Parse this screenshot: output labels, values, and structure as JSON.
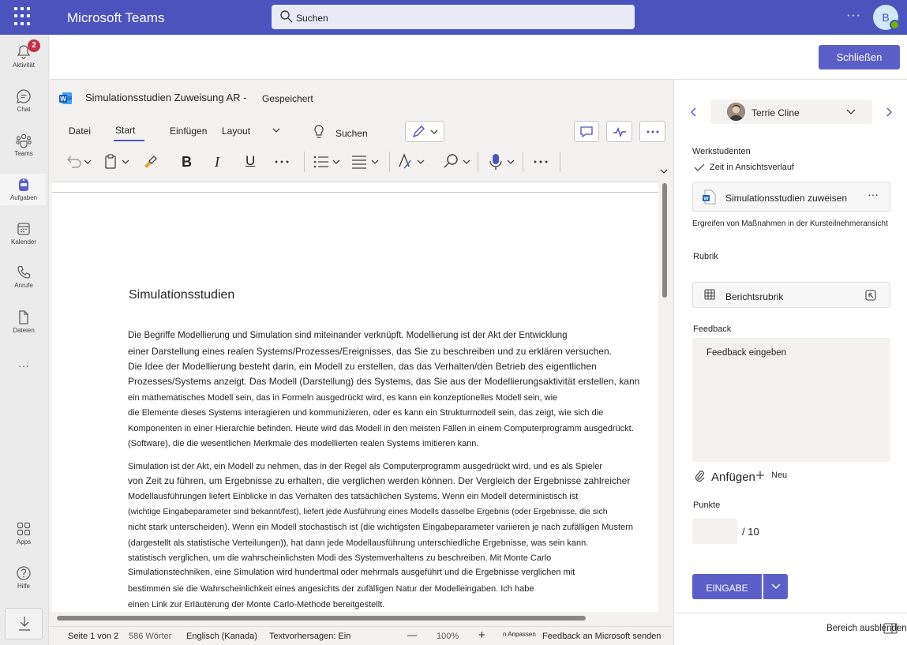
{
  "topbar": {
    "app_title": "Microsoft Teams",
    "search_placeholder": "Suchen",
    "more": "···",
    "avatar_initial": "B"
  },
  "rail": {
    "items": [
      {
        "label": "Aktivität",
        "icon": "bell-icon",
        "badge": "2"
      },
      {
        "label": "Chat",
        "icon": "chat-icon"
      },
      {
        "label": "Teams",
        "icon": "teams-icon"
      },
      {
        "label": "Aufgaben",
        "icon": "assignments-icon",
        "active": true
      },
      {
        "label": "Kalender",
        "icon": "calendar-icon"
      },
      {
        "label": "Anrufe",
        "icon": "phone-icon"
      },
      {
        "label": "Dateien",
        "icon": "file-icon"
      },
      {
        "label": "",
        "icon": "more-icon"
      },
      {
        "label": "Apps",
        "icon": "apps-icon"
      },
      {
        "label": "Hilfe",
        "icon": "help-icon"
      }
    ],
    "more_label": "···"
  },
  "header": {
    "close_label": "Schließen"
  },
  "document": {
    "title": "Simulationsstudien Zuweisung AR -",
    "saved": "Gespeichert",
    "tabs": [
      "Datei",
      "Start",
      "Einfügen",
      "Layout"
    ],
    "ribbon_search": "Suchen",
    "heading": "Simulationsstudien",
    "paragraph1": [
      "Die Begriffe Modellierung und Simulation sind miteinander verknüpft. Modellierung ist der Akt der Entwicklung",
      "einer Darstellung eines realen Systems/Prozesses/Ereignisses, das Sie zu beschreiben und zu erklären versuchen.",
      "Die Idee der Modellierung besteht darin, ein Modell zu erstellen, das das Verhalten/den Betrieb des eigentlichen",
      "Prozesses/Systems anzeigt. Das Modell (Darstellung) des Systems, das Sie aus der Modellierungsaktivität erstellen, kann",
      "ein mathematisches Modell sein, das in Formeln ausgedrückt wird, es kann ein konzeptionelles Modell sein, wie",
      "die Elemente dieses Systems interagieren und kommunizieren, oder es kann ein Strukturmodell sein, das zeigt, wie sich die",
      "Komponenten in einer Hierarchie befinden. Heute wird das Modell in den meisten Fällen in einem Computerprogramm ausgedrückt.",
      "(Software), die die wesentlichen Merkmale des modellierten realen Systems imitieren kann."
    ],
    "paragraph2": [
      "Simulation ist der Akt, ein Modell zu nehmen, das in der Regel als Computerprogramm ausgedrückt wird, und es als Spieler",
      "von Zeit zu führen, um Ergebnisse zu erhalten, die verglichen werden können. Der Vergleich der Ergebnisse zahlreicher",
      "Modellausführungen liefert Einblicke in das Verhalten des tatsächlichen Systems. Wenn ein Modell deterministisch ist",
      "(wichtige Eingabeparameter sind bekannt/fest), liefert jede Ausführung eines Modells dasselbe Ergebnis (oder Ergebnisse, die sich",
      "nicht stark unterscheiden). Wenn ein Modell stochastisch ist (die wichtigsten Eingabeparameter variieren je nach zufälligen Mustern",
      "(dargestellt als statistische Verteilungen)), hat dann jede Modellausführung unterschiedliche Ergebnisse, was sein kann.",
      "statistisch verglichen, um die wahrscheinlichsten Modi des Systemverhaltens zu beschreiben. Mit Monte Carlo",
      "Simulationstechniken, eine Simulation wird hundertmal oder mehrmals ausgeführt und die Ergebnisse verglichen mit",
      "bestimmen sie die Wahrscheinlichkeit eines angesichts der zufälligen Natur der Modelleingaben. Ich habe",
      "einen Link zur Erläuterung der Monte Carlo-Methode bereitgestellt."
    ]
  },
  "statusbar": {
    "page": "Seite 1 von 2",
    "words": "586 Wörter",
    "language": "Englisch (Kanada)",
    "predictions": "Textvorhersagen: Ein",
    "zoom_minus": "—",
    "zoom": "100%",
    "zoom_plus": "+",
    "fit": "n Anpassen",
    "feedback": "Feedback an Microsoft senden"
  },
  "right_panel": {
    "student_name": "Terrie Cline",
    "section_label": "Werkstudenten",
    "turned_in": "Zeit in Ansichtsverlauf",
    "file_name": "Simulationsstudien zuweisen",
    "file_more": "···",
    "file_note": "Ergreifen von Maßnahmen in der Kursteilnehmeransicht",
    "rubric_label": "Rubrik",
    "rubric_name": "Berichtsrubrik",
    "feedback_label": "Feedback",
    "feedback_placeholder": "Feedback eingeben",
    "attach": "Anfügen",
    "new": "Neu",
    "points_label": "Punkte",
    "points_max": "/ 10",
    "submit": "EINGABE",
    "hide_panel": "Bereich ausblenden"
  },
  "colors": {
    "brand": "#4b53bc",
    "button": "#5b5fc7",
    "badge": "#c4314b",
    "presence": "#6bb700"
  }
}
